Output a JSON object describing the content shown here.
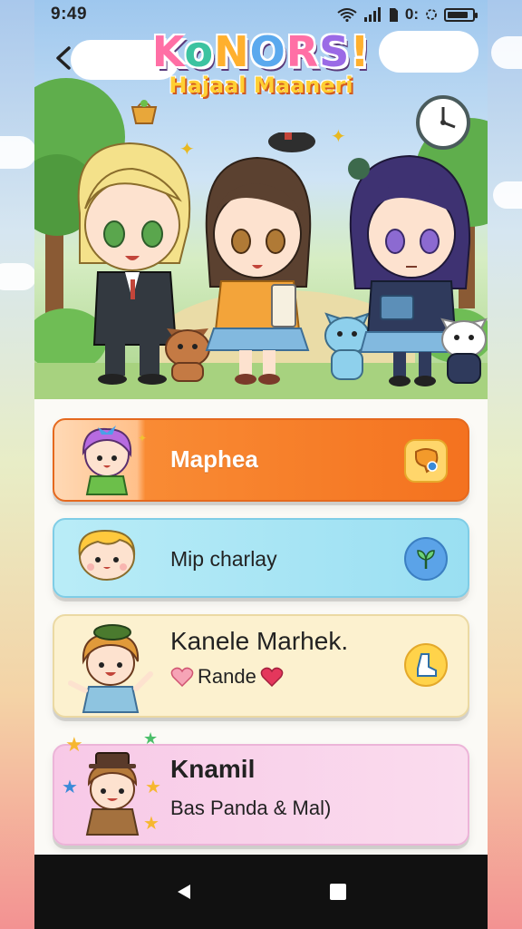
{
  "status_bar": {
    "time": "9:49",
    "right_text": "0:",
    "battery_level": 0.85
  },
  "hero": {
    "logo_title": "KoNORS!",
    "logo_subtitle": "Hajaal Maaneri"
  },
  "cards": [
    {
      "title": "Maphea",
      "subtitle": "",
      "action_icon": "chat-bubble-icon",
      "accent": "#f4721f"
    },
    {
      "title": "Mip charlay",
      "subtitle": "",
      "action_icon": "sprout-icon",
      "accent": "#5ba3e8"
    },
    {
      "title": "Kanele Marhek.",
      "subtitle": "Rande",
      "action_icon": "boot-icon",
      "accent": "#ffd34a"
    },
    {
      "title": "Knamil",
      "subtitle": "Bas Panda & Mal)",
      "action_icon": "",
      "accent": "#f8c9e7"
    }
  ],
  "nav": {
    "back_icon": "triangle-back-icon",
    "recents_icon": "square-recents-icon"
  }
}
